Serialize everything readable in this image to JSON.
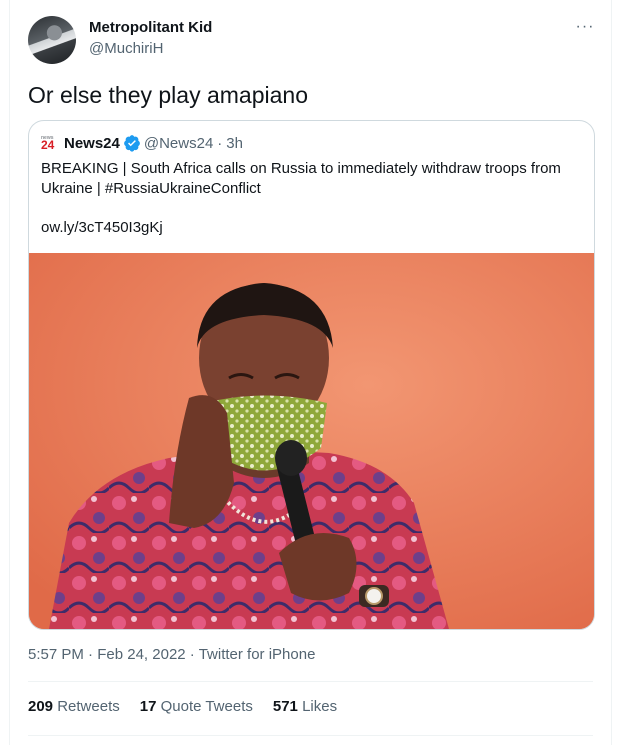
{
  "author": {
    "name": "Metropolitant Kid",
    "handle": "@MuchiriH"
  },
  "tweet": {
    "text": "Or else they play amapiano"
  },
  "more_label": "···",
  "quoted": {
    "logo_small": "news",
    "logo_number": "24",
    "name": "News24",
    "handle": "@News24",
    "time": "3h",
    "separator": "·",
    "text": "BREAKING | South Africa calls on Russia to immediately withdraw troops from Ukraine | #RussiaUkraineConflict",
    "link": "ow.ly/3cT450I3gKj"
  },
  "meta": {
    "time": "5:57 PM",
    "date": "Feb 24, 2022",
    "source": "Twitter for iPhone",
    "separator": "·"
  },
  "stats": [
    {
      "count": "209",
      "label": "Retweets"
    },
    {
      "count": "17",
      "label": "Quote Tweets"
    },
    {
      "count": "571",
      "label": "Likes"
    }
  ],
  "colors": {
    "accent": "#1d9bf0",
    "text": "#0f1419",
    "secondary": "#536471",
    "border": "#cfd9de"
  }
}
